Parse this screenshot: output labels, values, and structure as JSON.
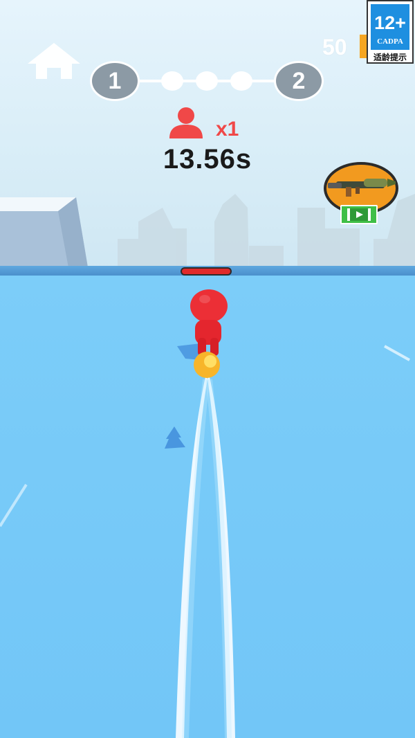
{
  "hud": {
    "coins": "50",
    "enemy_multiplier": "x1",
    "timer": "13.56s"
  },
  "level_progress": {
    "current_level": "1",
    "next_level": "2",
    "stage_dots": 3
  },
  "age_rating": {
    "age": "12+",
    "org": "CADPA",
    "note": "适龄提示"
  },
  "icons": {
    "home": "home-icon",
    "enemy": "person-icon",
    "coin": "coin-icon",
    "weapon": "rocket-launcher-icon",
    "video": "play-video-icon"
  },
  "colors": {
    "accent_red": "#f04848",
    "water": "#77c8f8",
    "level_node": "#8c9aa5",
    "video_button": "#3fbf47",
    "badge_blue": "#1e8fe0",
    "boss_health": "#e02a2a"
  }
}
